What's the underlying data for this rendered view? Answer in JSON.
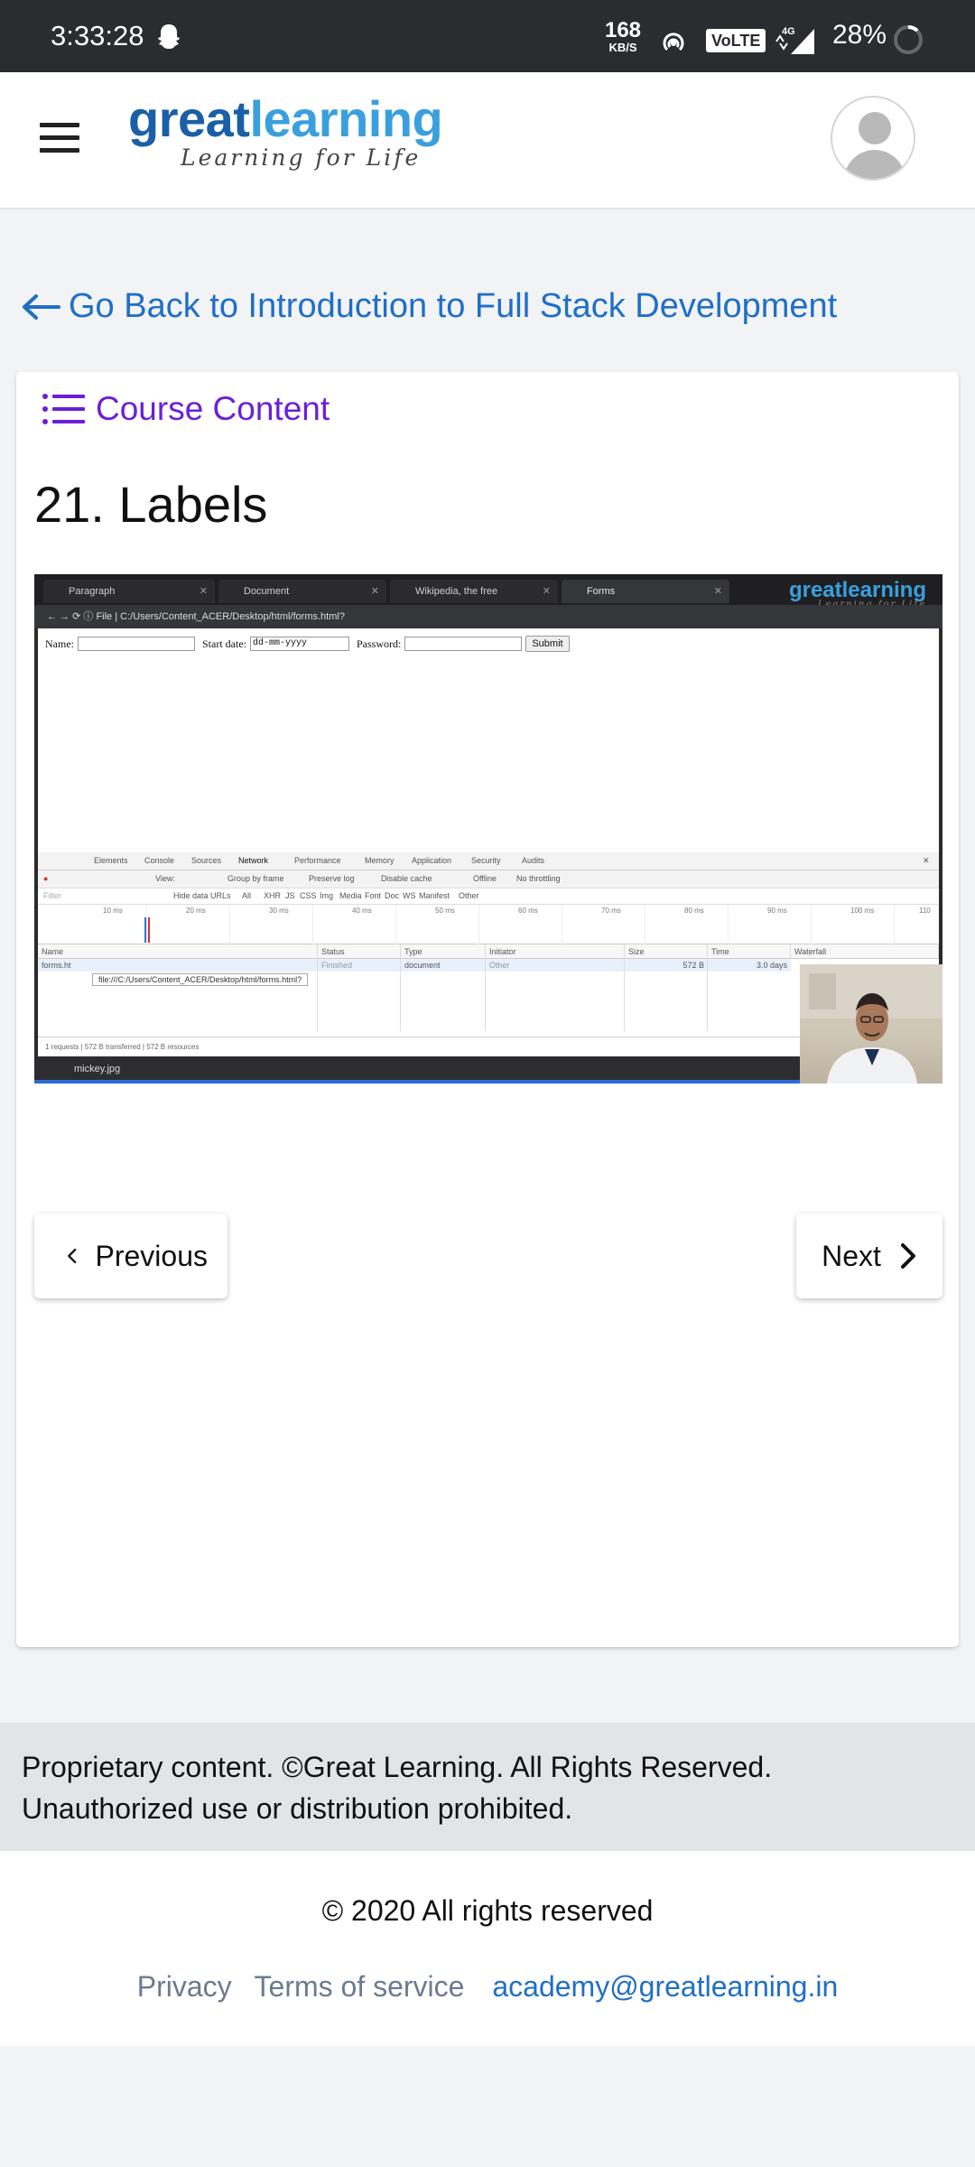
{
  "status_bar": {
    "time": "3:33:28",
    "speed_value": "168",
    "speed_unit": "KB/S",
    "volte": "VoLTE",
    "network": "4G",
    "battery": "28%"
  },
  "header": {
    "logo_part1": "great",
    "logo_part2": "learning",
    "logo_tagline": "Learning for Life"
  },
  "back_link": "Go Back to Introduction to Full Stack Development",
  "course_content_label": "Course Content",
  "lesson_title": "21. Labels",
  "video": {
    "tabs": [
      "Paragraph",
      "Document",
      "Wikipedia, the free encyclopedia",
      "Forms"
    ],
    "address": "File  |  C:/Users/Content_ACER/Desktop/html/forms.html?",
    "form_name_label": "Name:",
    "form_date_label": "Start date:",
    "form_date_value": "dd-mm-yyyy",
    "form_password_label": "Password:",
    "form_submit": "Submit",
    "devtools_tabs": [
      "Elements",
      "Console",
      "Sources",
      "Network",
      "Performance",
      "Memory",
      "Application",
      "Security",
      "Audits"
    ],
    "devtools_options": [
      "View:",
      "Group by frame",
      "Preserve log",
      "Disable cache",
      "Offline",
      "No throttling"
    ],
    "filter_placeholder": "Filter",
    "filter_types": [
      "Hide data URLs",
      "All",
      "XHR",
      "JS",
      "CSS",
      "Img",
      "Media",
      "Font",
      "Doc",
      "WS",
      "Manifest",
      "Other"
    ],
    "timeline_ticks": [
      "10 ms",
      "20 ms",
      "30 ms",
      "40 ms",
      "50 ms",
      "60 ms",
      "70 ms",
      "80 ms",
      "90 ms",
      "100 ms",
      "110"
    ],
    "columns": [
      "Name",
      "Status",
      "Type",
      "Initiator",
      "Size",
      "Time",
      "Waterfall"
    ],
    "row": {
      "name": "forms.ht",
      "status": "Finished",
      "type": "document",
      "initiator": "Other",
      "size": "572 B",
      "time": "3.0 days"
    },
    "tooltip": "file:///C:/Users/Content_ACER/Desktop/html/forms.html?",
    "summary": [
      "1 requests",
      "572 B transferred",
      "572 B resources"
    ],
    "download_file": "mickey.jpg",
    "overlay_logo": "greatlearning",
    "overlay_tagline": "Learning for Life"
  },
  "nav": {
    "previous": "Previous",
    "next": "Next"
  },
  "notice_line1": "Proprietary content. ©Great Learning. All Rights Reserved.",
  "notice_line2": "Unauthorized use or distribution prohibited.",
  "footer": {
    "copyright": "© 2020 All rights reserved",
    "privacy": "Privacy",
    "terms": "Terms of service",
    "email": "academy@greatlearning.in"
  },
  "colors": {
    "link_blue": "#1f6fc7",
    "course_purple": "#6b1fd8",
    "status_bar": "#2a2c30"
  }
}
